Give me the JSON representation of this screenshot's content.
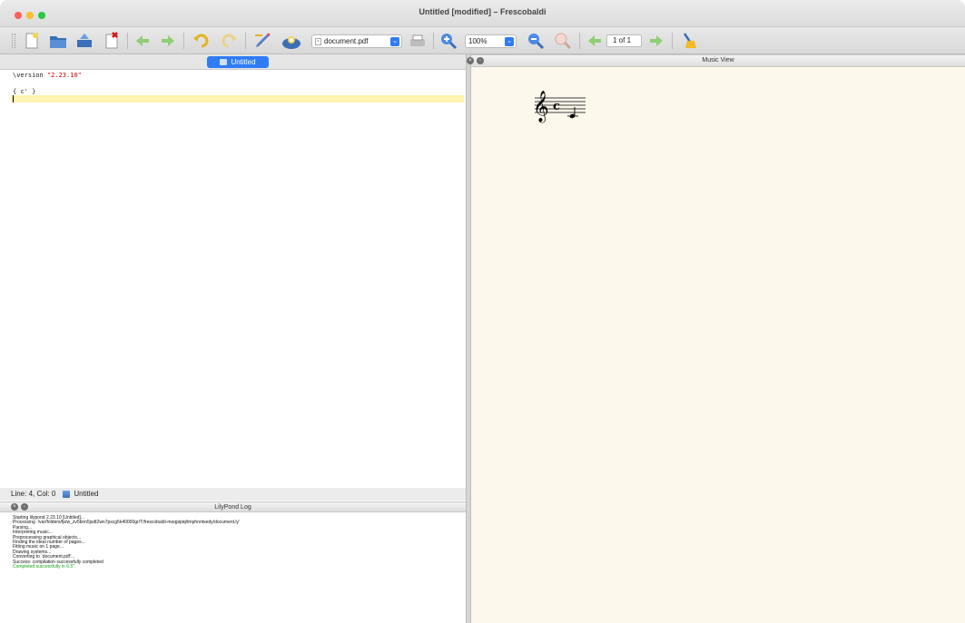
{
  "window": {
    "title": "Untitled [modified] – Frescobaldi"
  },
  "toolbar": {
    "document_select": "document.pdf",
    "zoom": "100%",
    "page": "1 of 1"
  },
  "tabs": [
    {
      "label": "Untitled"
    }
  ],
  "editor": {
    "line1_cmd": "\\version ",
    "line1_str": "\"2.23.10\"",
    "line2": "",
    "line3": "{ c' }"
  },
  "status": {
    "position": "Line: 4, Col: 0",
    "doc": "Untitled"
  },
  "panels": {
    "music_view": "Music View",
    "log_title": "LilyPond Log"
  },
  "log": {
    "lines": [
      "Starting lilypond 2.23.10 [Untitled]...",
      "Processing `/var/folders/fp/w_zv5bnn5jsdt2wn7pxcg5k40000gr/T/frescobaldi-moqpipiq/tmphnntsedy/document.ly'",
      "Parsing...",
      "Interpreting music...",
      "Preprocessing graphical objects...",
      "Finding the ideal number of pages...",
      "Fitting music on 1 page...",
      "Drawing systems...",
      "Converting to `document.pdf'...",
      "Success: compilation successfully completed"
    ],
    "completed": "Completed successfully in 6.5\"."
  },
  "colors": {
    "accent": "#2f7cf6",
    "current_line": "#fff4b0",
    "music_bg": "#fdf8ec",
    "success": "#1aa01a"
  }
}
